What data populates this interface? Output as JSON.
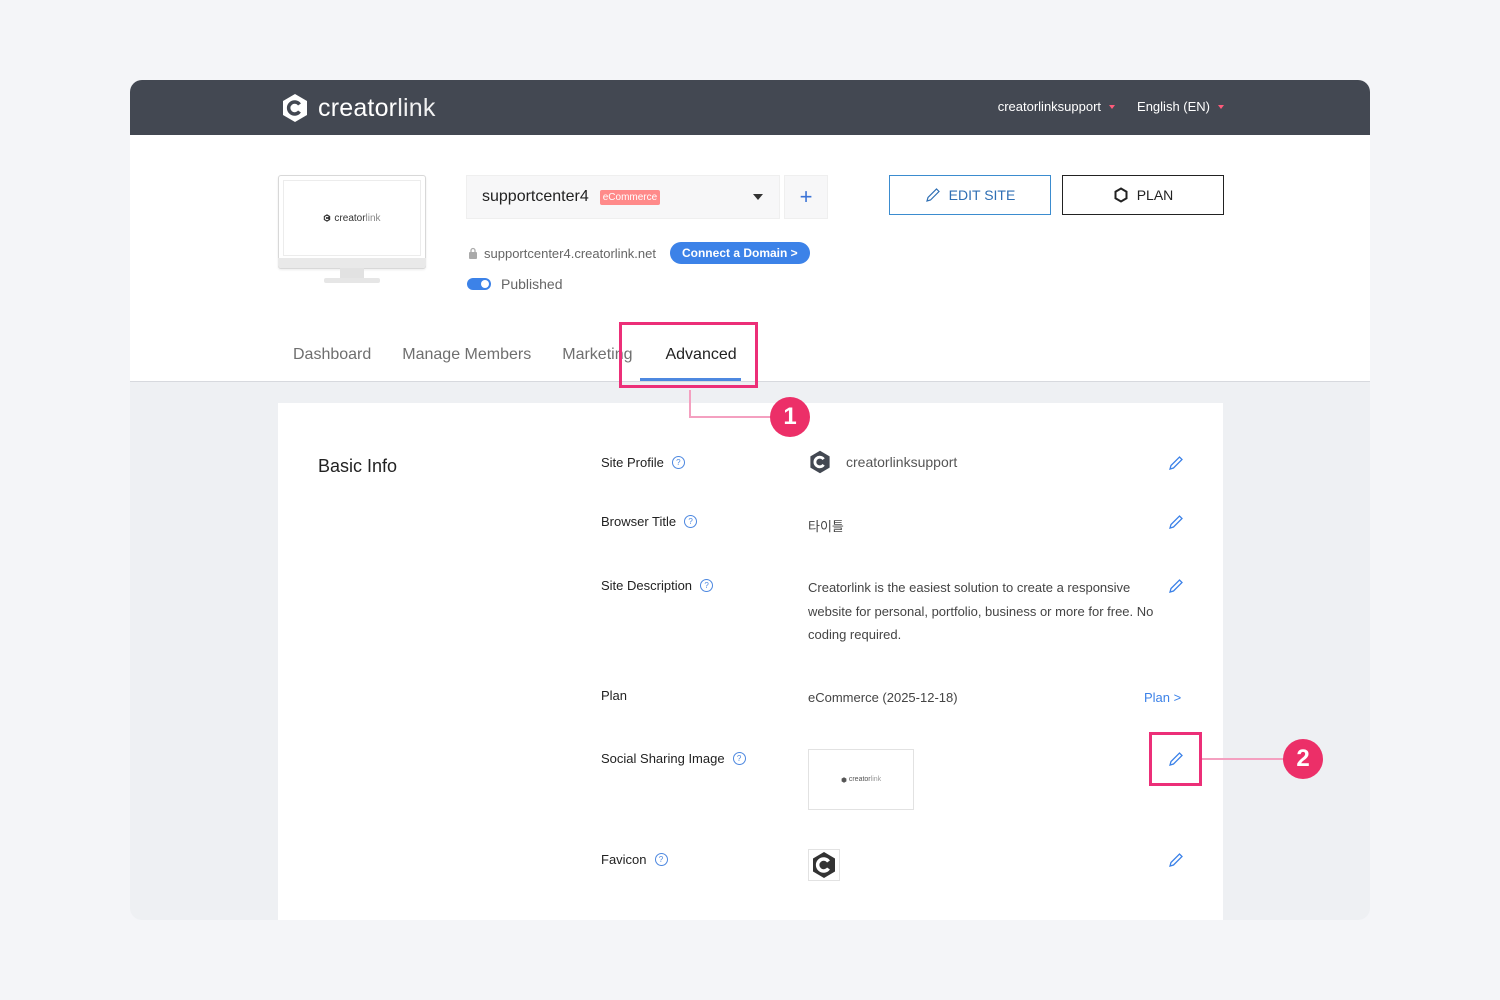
{
  "brand": {
    "logo_bold": "creator",
    "logo_light": "link"
  },
  "topnav": {
    "account": "creatorlinksupport",
    "language": "English (EN)"
  },
  "site": {
    "name": "supportcenter4",
    "plan_badge": "eCommerce",
    "url": "supportcenter4.creatorlink.net",
    "connect_domain": "Connect a Domain >",
    "status": "Published",
    "preview_logo_bold": "creator",
    "preview_logo_light": "link"
  },
  "actions": {
    "edit_site": "EDIT SITE",
    "plan": "PLAN"
  },
  "tabs": [
    {
      "label": "Dashboard"
    },
    {
      "label": "Manage Members"
    },
    {
      "label": "Marketing"
    },
    {
      "label": "Advanced"
    }
  ],
  "panel": {
    "title": "Basic Info",
    "rows": {
      "site_profile": {
        "label": "Site Profile",
        "value": "creatorlinksupport"
      },
      "browser_title": {
        "label": "Browser Title",
        "value": "타이틀"
      },
      "site_description": {
        "label": "Site Description",
        "value": "Creatorlink is the easiest solution to create a responsive website for personal, portfolio, business or more for free. No coding required."
      },
      "plan": {
        "label": "Plan",
        "value": "eCommerce (2025-12-18)",
        "link": "Plan >"
      },
      "social_image": {
        "label": "Social Sharing Image",
        "thumb_bold": "creator",
        "thumb_light": "link"
      },
      "favicon": {
        "label": "Favicon"
      }
    }
  },
  "callouts": {
    "one": "1",
    "two": "2"
  },
  "colors": {
    "accent": "#3c82e8",
    "highlight": "#ec2f78",
    "topbar": "#434852",
    "badge": "#ff8a8a"
  }
}
